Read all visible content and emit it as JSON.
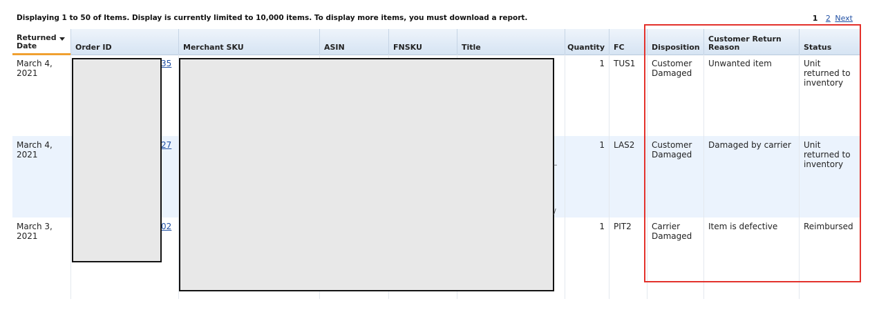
{
  "header": {
    "info_text": "Displaying 1 to 50 of Items. Display is currently limited to 10,000 items. To display more items, you must download a report.",
    "pager": {
      "current": "1",
      "page2": "2",
      "next": "Next"
    }
  },
  "table": {
    "columns": {
      "returned_date": "Returned Date",
      "order_id": "Order ID",
      "merchant_sku": "Merchant SKU",
      "asin": "ASIN",
      "fnsku": "FNSKU",
      "title": "Title",
      "quantity": "Quantity",
      "fc": "FC",
      "disposition": "Disposition",
      "reason": "Customer Return Reason",
      "status": "Status"
    },
    "rows": [
      {
        "date": "March 4, 2021",
        "order_suffix": "35",
        "quantity": "1",
        "fc": "TUS1",
        "disposition": "Customer Damaged",
        "reason": "Unwanted item",
        "status": "Unit returned to inventory"
      },
      {
        "date": "March 4, 2021",
        "order_suffix": "27",
        "quantity": "1",
        "fc": "LAS2",
        "disposition": "Customer Damaged",
        "reason": "Damaged by carrier",
        "status": "Unit returned to inventory"
      },
      {
        "date": "March 3, 2021",
        "order_suffix": "02",
        "quantity": "1",
        "fc": "PIT2",
        "disposition": "Carrier Damaged",
        "reason": "Item is defective",
        "status": "Reimbursed"
      }
    ]
  }
}
